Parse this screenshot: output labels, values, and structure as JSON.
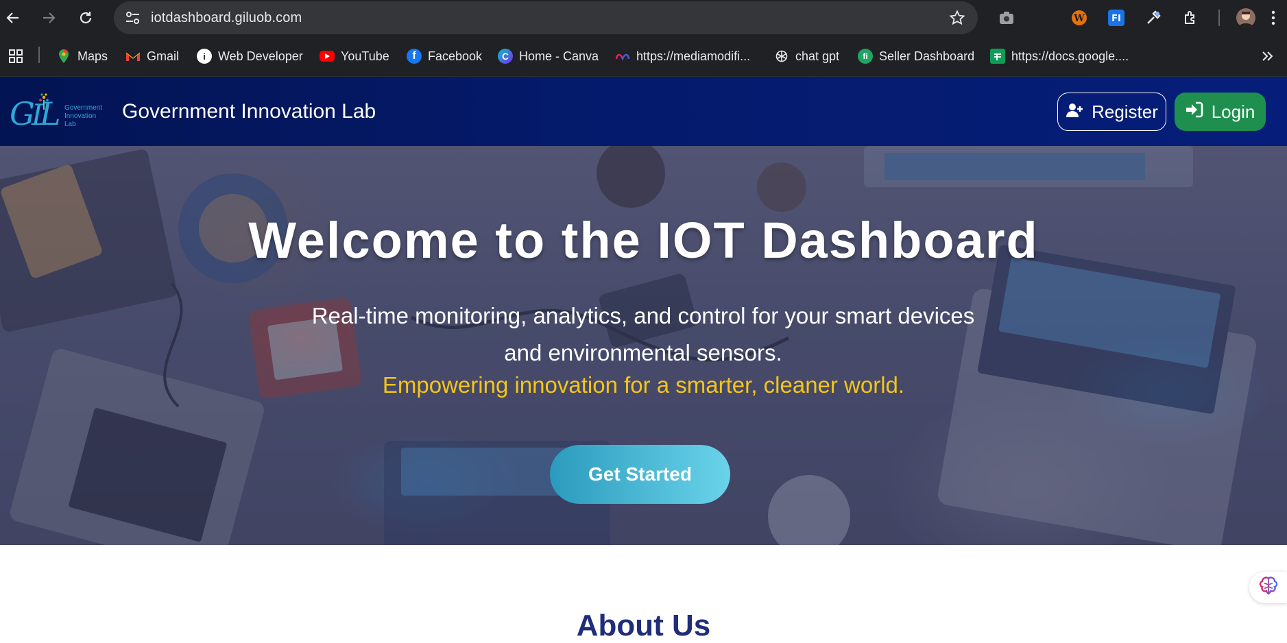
{
  "browser": {
    "url": "iotdashboard.giluob.com",
    "icons": [
      "back-icon",
      "forward-icon",
      "reload-icon",
      "site-settings-icon",
      "bookmark-star-icon",
      "camera-icon",
      "wordpress-icon",
      "fi-extension-icon",
      "eyedropper-icon",
      "extensions-puzzle-icon",
      "profile-avatar",
      "kebab-menu-icon"
    ]
  },
  "bookmarks": [
    {
      "label": "Maps",
      "icon": "maps-icon"
    },
    {
      "label": "Gmail",
      "icon": "gmail-icon"
    },
    {
      "label": "Web Developer",
      "icon": "info-icon"
    },
    {
      "label": "YouTube",
      "icon": "youtube-icon"
    },
    {
      "label": "Facebook",
      "icon": "facebook-icon"
    },
    {
      "label": "Home - Canva",
      "icon": "canva-icon"
    },
    {
      "label": "https://mediamodifi...",
      "icon": "meta-icon"
    },
    {
      "label": "chat gpt",
      "icon": "openai-icon"
    },
    {
      "label": "Seller Dashboard",
      "icon": "fi-icon"
    },
    {
      "label": "https://docs.google....",
      "icon": "sheets-icon"
    }
  ],
  "header": {
    "logo_text": "GIL",
    "logo_sub": [
      "Government",
      "Innovation",
      "Lab"
    ],
    "title": "Government Innovation Lab",
    "register_label": "Register",
    "login_label": "Login"
  },
  "hero": {
    "title": "Welcome to the IOT Dashboard",
    "subtitle": "Real-time monitoring, analytics, and control for your smart devices and environmental sensors.",
    "tagline": "Empowering innovation for a smarter, cleaner world.",
    "cta_label": "Get Started"
  },
  "about": {
    "title": "About Us"
  },
  "colors": {
    "header_bg": "#041a6b",
    "login_bg": "#1e8f4e",
    "tagline": "#f5c518",
    "cta_from": "#2b9bbd",
    "cta_to": "#6ad3ea",
    "about_title": "#1f2d7a"
  }
}
